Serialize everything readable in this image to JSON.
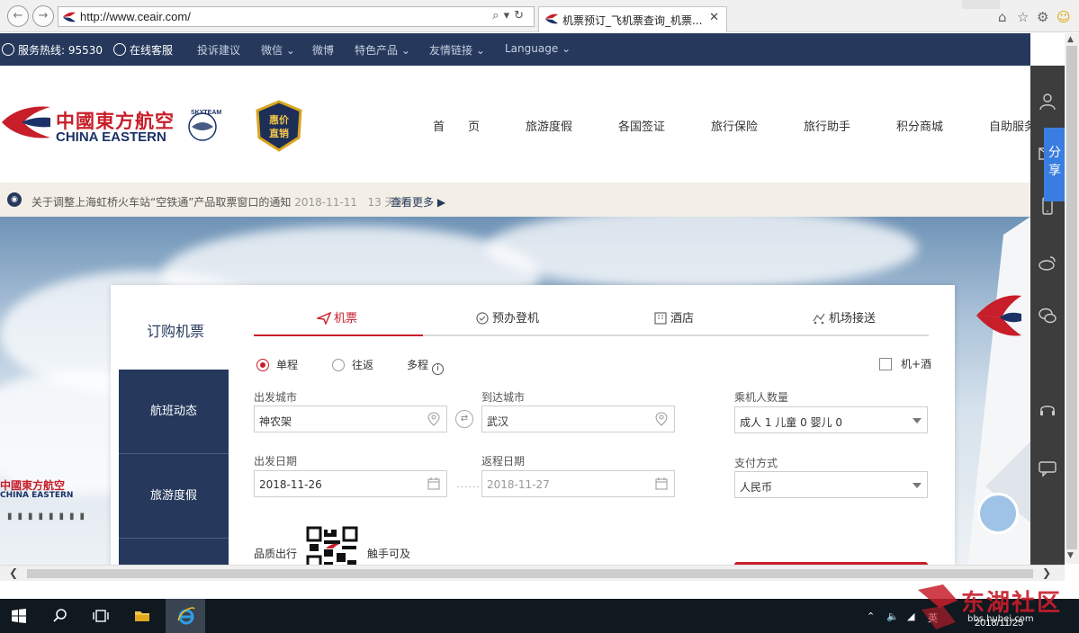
{
  "browser": {
    "url": "http://www.ceair.com/",
    "tab_title": "机票预订_飞机票查询_机票...",
    "colors": {
      "chrome": "#f0f0f0"
    }
  },
  "topbar": {
    "hotline": "服务热线: 95530",
    "online_service": "在线客服",
    "items": [
      "投诉建议",
      "微信",
      "微博",
      "特色产品",
      "友情链接",
      "Language"
    ],
    "colors": {
      "background": "#26395d"
    }
  },
  "header": {
    "brand_cn": "中國東方航空",
    "brand_en": "CHINA EASTERN",
    "skyteam": "SKYTEAM",
    "badge": "惠价直销",
    "nav": [
      "首　　页",
      "旅游度假",
      "各国签证",
      "旅行保险",
      "旅行助手",
      "积分商城",
      "自助服务"
    ],
    "colors": {
      "brand_red": "#c81e2a",
      "brand_navy": "#1b3167"
    }
  },
  "notice": {
    "text": "关于调整上海虹桥火车站“空铁通”产品取票窗口的通知",
    "date": "2018-11-11",
    "ago": "13 天前",
    "more": "查看更多"
  },
  "hero": {
    "plane_cn": "中國東方航空",
    "plane_en": "CHINA EASTERN"
  },
  "booking": {
    "title": "订购机票",
    "side_tabs": [
      "航班动态",
      "旅游度假"
    ],
    "tabs": [
      "机票",
      "预办登机",
      "酒店",
      "机场接送"
    ],
    "trip_types": [
      "单程",
      "往返",
      "多程"
    ],
    "selected_trip": "单程",
    "combo": "机+酒",
    "from_label": "出发城市",
    "from_value": "神农架",
    "to_label": "到达城市",
    "to_value": "武汉",
    "pax_label": "乘机人数量",
    "pax_value": "成人 1  儿童 0  婴儿 0",
    "depart_label": "出发日期",
    "depart_value": "2018-11-26",
    "return_label": "返程日期",
    "return_value": "2018-11-27",
    "pay_label": "支付方式",
    "pay_value": "人民币",
    "promo_left": "品质出行",
    "promo_right": "触手可及"
  },
  "sidebar": {
    "share": "分享",
    "icons": [
      "user-icon",
      "mail-icon",
      "phone-icon",
      "weibo-icon",
      "wechat-icon",
      "headset-icon",
      "chat-icon"
    ]
  },
  "taskbar": {
    "ime": "英",
    "time": "2018/11/25",
    "icons": [
      "windows-icon",
      "search-icon",
      "task-view-icon",
      "file-explorer-icon",
      "ie-icon"
    ]
  },
  "watermark": {
    "text": "东湖社区",
    "sub": "bbs.hubei.com"
  }
}
